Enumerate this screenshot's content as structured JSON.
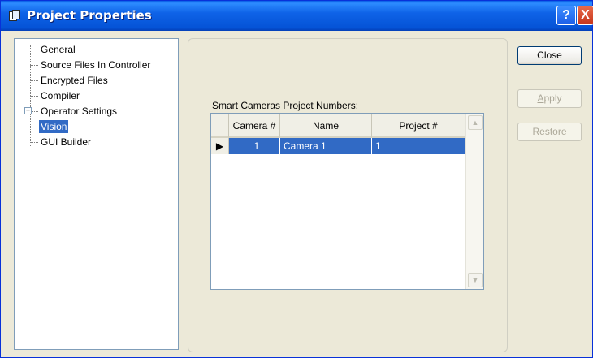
{
  "window": {
    "title": "Project Properties",
    "help_glyph": "?",
    "close_glyph": "X",
    "icon": "project-properties-icon"
  },
  "tree": {
    "items": [
      {
        "label": "General",
        "selected": false
      },
      {
        "label": "Source Files In Controller",
        "selected": false
      },
      {
        "label": "Encrypted Files",
        "selected": false
      },
      {
        "label": "Compiler",
        "selected": false
      },
      {
        "label": "Operator Settings",
        "selected": false,
        "expander": "+"
      },
      {
        "label": "Vision",
        "selected": true
      },
      {
        "label": "GUI Builder",
        "selected": false
      }
    ]
  },
  "grid": {
    "label_mnemonic": "S",
    "label_rest": "mart Cameras Project Numbers:",
    "columns": [
      "Camera #",
      "Name",
      "Project #"
    ],
    "rows": [
      {
        "indicator": "▶",
        "camera": "1",
        "name": "Camera 1",
        "project": "1"
      }
    ],
    "scroll_up": "▲",
    "scroll_down": "▼"
  },
  "buttons": {
    "close": "Close",
    "apply_mnemonic": "A",
    "apply_rest": "pply",
    "restore_mnemonic": "R",
    "restore_rest": "estore"
  },
  "colors": {
    "selection": "#316ac5",
    "titlebar": "#0553d6",
    "face": "#ece9d8"
  }
}
